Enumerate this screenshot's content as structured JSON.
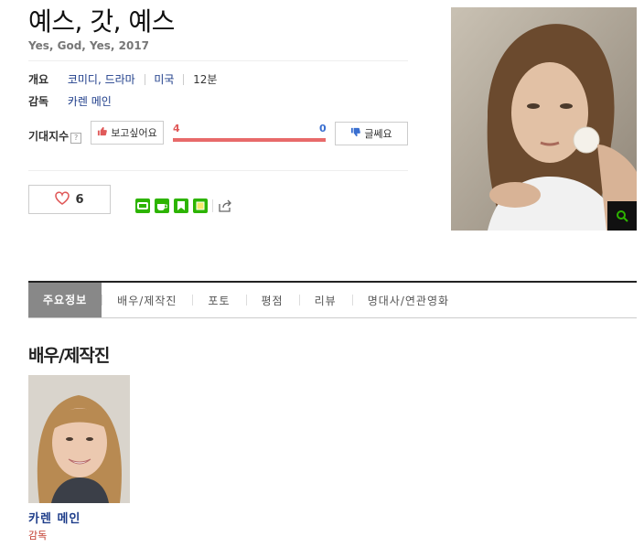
{
  "movie": {
    "title": "예스, 갓, 예스",
    "subtitle": "Yes, God, Yes, 2017"
  },
  "info": {
    "overview_label": "개요",
    "genre": "코미디, 드라마",
    "country": "미국",
    "rating": "12분",
    "director_label": "감독",
    "director": "카렌 메인"
  },
  "expectation": {
    "label": "기대지수",
    "help_icon": "?",
    "want_label": "보고싶어요",
    "meh_label": "글쎄요",
    "want_count": "4",
    "meh_count": "0",
    "want_ratio": 1.0
  },
  "like": {
    "count": "6",
    "icon": "heart-outline-icon",
    "color": "#e05a5a"
  },
  "share": {
    "icons": [
      "band-icon",
      "cafe-icon",
      "bookmark-icon",
      "memo-icon",
      "share-icon"
    ]
  },
  "tabs": [
    "주요정보",
    "배우/제작진",
    "포토",
    "평점",
    "리뷰",
    "명대사/연관영화"
  ],
  "active_tab": 0,
  "cast_section": {
    "title": "배우/제작진",
    "members": [
      {
        "name": "카렌 메인",
        "role": "감독"
      }
    ]
  },
  "colors": {
    "accent_blue": "#1e3d8a",
    "want_red": "#e05a5a",
    "meh_blue": "#3a6fd0",
    "role_red": "#c0392b",
    "share_green": "#2db400"
  }
}
